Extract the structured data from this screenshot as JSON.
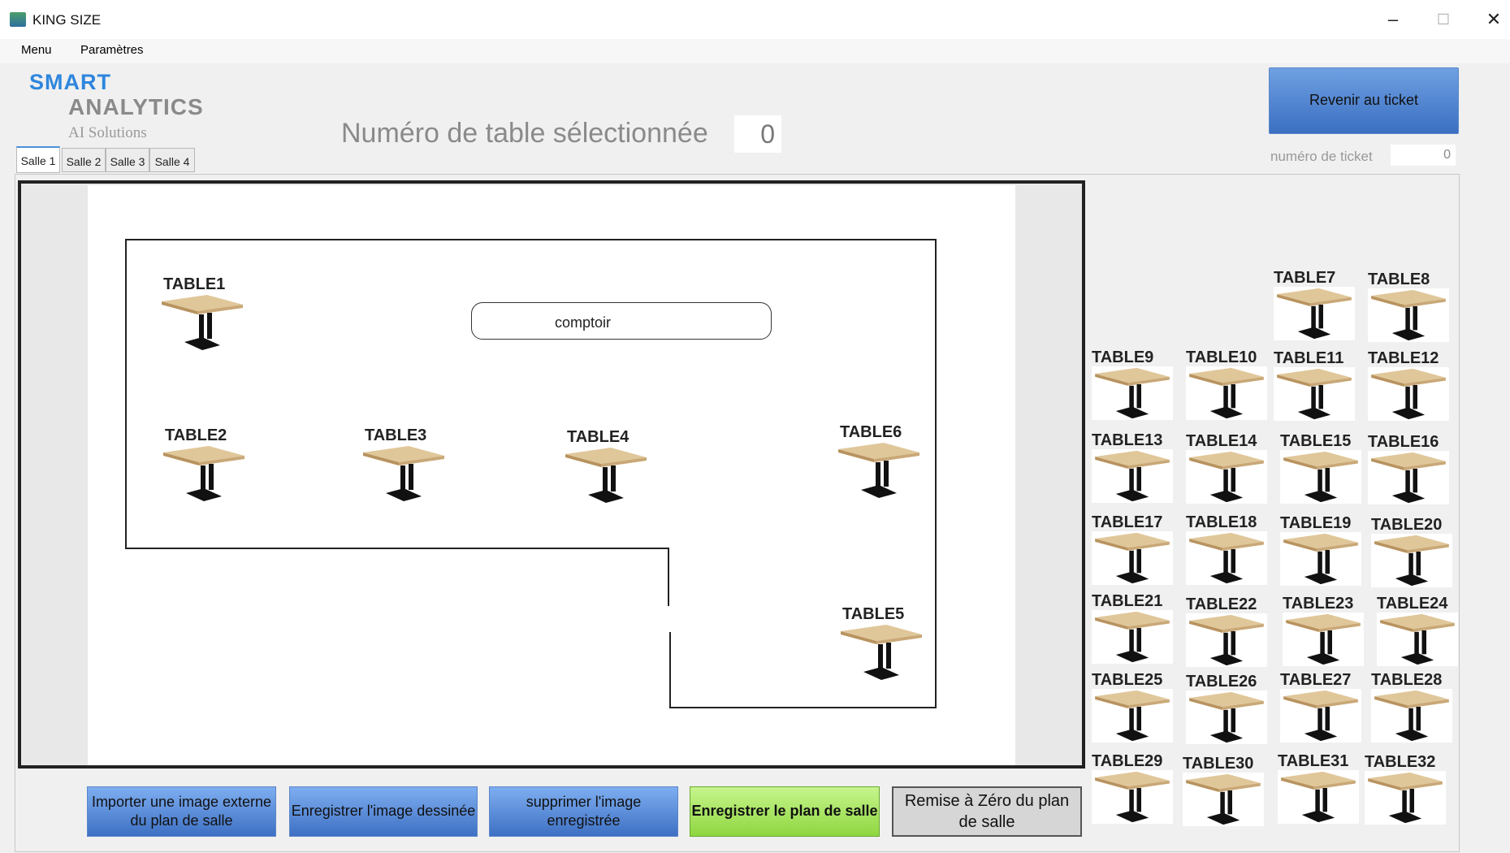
{
  "window": {
    "title": "KING SIZE",
    "minimize_icon": "minimize-icon",
    "maximize_icon": "maximize-icon",
    "close_icon": "close-icon"
  },
  "menu": {
    "items": [
      "Menu",
      "Paramètres"
    ]
  },
  "logo": {
    "line1": "SMART",
    "line2": "ANALYTICS",
    "line3": "AI Solutions"
  },
  "selection": {
    "label": "Numéro de table sélectionnée",
    "value": "0"
  },
  "tabs": [
    "Salle 1",
    "Salle 2",
    "Salle 3",
    "Salle 4"
  ],
  "plan": {
    "counter_label": "comptoir",
    "tables": [
      "TABLE1",
      "TABLE2",
      "TABLE3",
      "TABLE4",
      "TABLE6",
      "TABLE5"
    ]
  },
  "side_tables": [
    "TABLE7",
    "TABLE8",
    "TABLE9",
    "TABLE10",
    "TABLE11",
    "TABLE12",
    "TABLE13",
    "TABLE14",
    "TABLE15",
    "TABLE16",
    "TABLE17",
    "TABLE18",
    "TABLE19",
    "TABLE20",
    "TABLE21",
    "TABLE22",
    "TABLE23",
    "TABLE24",
    "TABLE25",
    "TABLE26",
    "TABLE27",
    "TABLE28",
    "TABLE29",
    "TABLE30",
    "TABLE31",
    "TABLE32"
  ],
  "ticket": {
    "button": "Revenir au ticket",
    "label": "numéro de ticket",
    "value": "0"
  },
  "buttons": {
    "import": "Importer une image externe du plan de salle",
    "save_image": "Enregistrer l'image dessinée",
    "delete_image": "supprimer l'image enregistrée",
    "save_plan": "Enregistrer le plan de salle",
    "reset": "Remise à Zéro du plan de salle"
  },
  "colors": {
    "accent_blue": "#3b6fc1",
    "save_green": "#8fd640",
    "logo_blue": "#2e86de"
  }
}
